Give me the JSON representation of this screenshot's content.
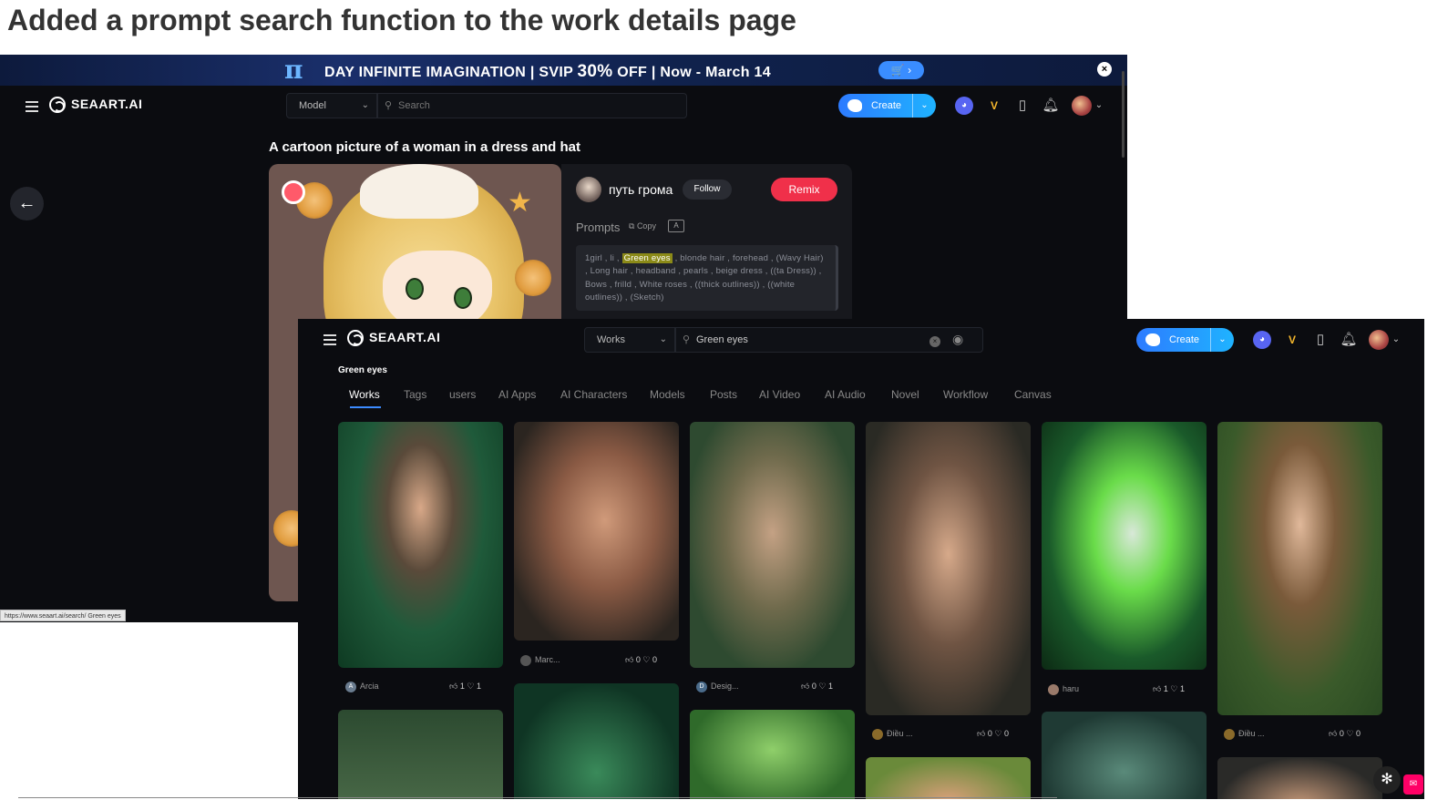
{
  "heading": "Added a prompt search function to the work details page",
  "banner": {
    "logo_glyph": "π",
    "text_main": "DAY INFINITE IMAGINATION | SVIP ",
    "text_pct": "30%",
    "text_tail": " OFF | Now - March 14",
    "cart": "🛒 ›",
    "close": "×"
  },
  "back_window": {
    "logo": "SEAART.AI",
    "nav_select": "Model",
    "search_placeholder": "Search",
    "create_label": "Create",
    "work_title": "A cartoon picture of a woman in a dress and hat",
    "author": "путь грома",
    "follow_label": "Follow",
    "remix_label": "Remix",
    "prompts_label": "Prompts",
    "copy_label": "Copy",
    "translate_label": "A",
    "prompt_pre": "1girl , li , ",
    "prompt_highlight": "Green eyes",
    "prompt_post": " , blonde hair , forehead , (Wavy Hair) , Long hair , headband , pearls , beige dress , ((ta Dress)) , Bows , frilld , White roses , ((thick outlines)) , ((white outlines)) , (Sketch)",
    "status_url": "https://www.seaart.ai/search/ Green eyes"
  },
  "front_window": {
    "logo": "SEAART.AI",
    "nav_select": "Works",
    "search_value": "Green eyes",
    "create_label": "Create",
    "results_title": "Green eyes",
    "tabs": [
      "Works",
      "Tags",
      "users",
      "AI Apps",
      "AI Characters",
      "Models",
      "Posts",
      "AI Video",
      "AI Audio",
      "Novel",
      "Workflow",
      "Canvas"
    ],
    "cards": [
      {
        "author": "Arcia",
        "avatar": "A",
        "likes": "1",
        "hearts": "1"
      },
      {
        "author": "Marc...",
        "avatar": "",
        "likes": "0",
        "hearts": "0"
      },
      {
        "author": "Desig...",
        "avatar": "D",
        "likes": "0",
        "hearts": "1"
      },
      {
        "author": "Điều ...",
        "avatar": "",
        "likes": "0",
        "hearts": "0"
      },
      {
        "author": "haru",
        "avatar": "",
        "likes": "1",
        "hearts": "1"
      },
      {
        "author": "Điều ...",
        "avatar": "",
        "likes": "0",
        "hearts": "0"
      }
    ]
  },
  "icons": {
    "menu": "menu-icon",
    "search": "search-icon",
    "camera": "camera-icon",
    "discord": "discord-icon",
    "vip": "vip-icon",
    "phone": "phone-icon",
    "bell": "bell-icon"
  },
  "colors": {
    "accent": "#2d7bff",
    "remix": "#f0304a",
    "highlight": "#8b8a18",
    "bg": "#0b0c10"
  }
}
